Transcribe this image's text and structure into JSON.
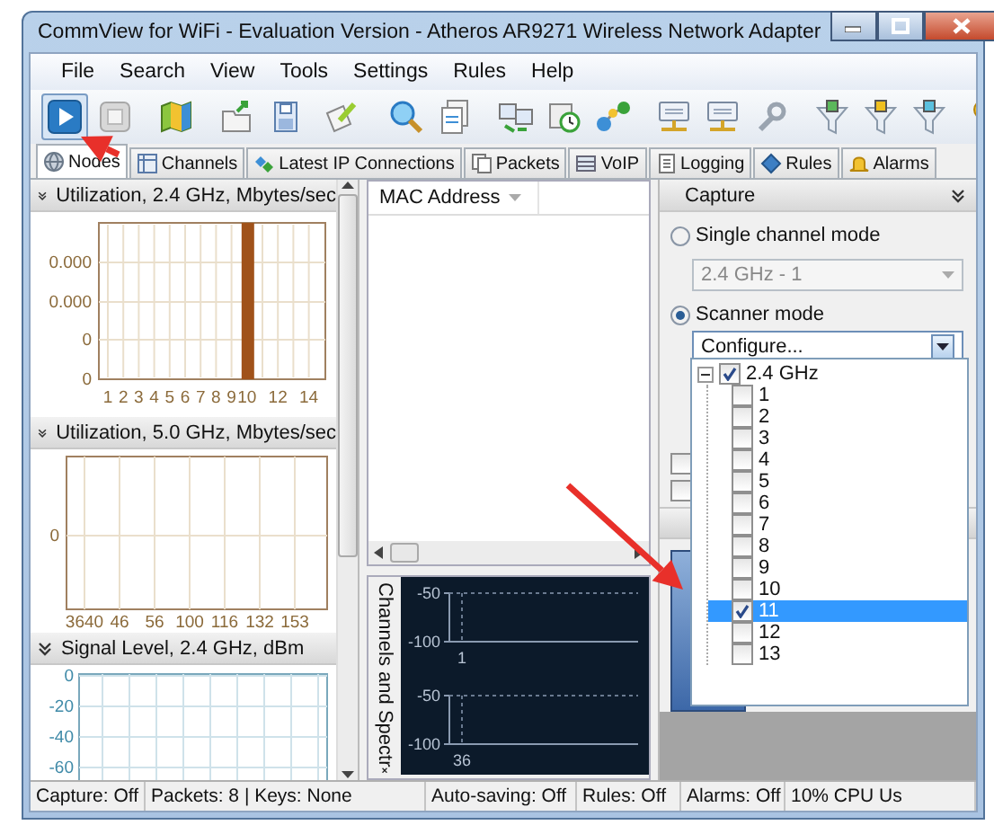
{
  "window": {
    "title": "CommView for WiFi - Evaluation Version - Atheros AR9271 Wireless Network Adapter"
  },
  "menu": [
    "File",
    "Search",
    "View",
    "Tools",
    "Settings",
    "Rules",
    "Help"
  ],
  "toolbar": [
    {
      "kind": "play",
      "pressed": true
    },
    {
      "kind": "stop",
      "pressed": false
    },
    {
      "kind": "separator"
    },
    {
      "kind": "map",
      "pressed": false
    },
    {
      "kind": "separator"
    },
    {
      "kind": "open",
      "pressed": false
    },
    {
      "kind": "save",
      "pressed": false
    },
    {
      "kind": "export",
      "pressed": false
    },
    {
      "kind": "separator"
    },
    {
      "kind": "search",
      "pressed": false
    },
    {
      "kind": "reports",
      "pressed": false
    },
    {
      "kind": "separator"
    },
    {
      "kind": "nodes",
      "pressed": false
    },
    {
      "kind": "schedule",
      "pressed": false
    },
    {
      "kind": "network",
      "pressed": false
    },
    {
      "kind": "separator"
    },
    {
      "kind": "device",
      "pressed": false
    },
    {
      "kind": "device",
      "pressed": false
    },
    {
      "kind": "wrench",
      "pressed": false
    },
    {
      "kind": "separator"
    },
    {
      "kind": "filtergreen",
      "pressed": false
    },
    {
      "kind": "filteryellow",
      "pressed": false
    },
    {
      "kind": "filterblue",
      "pressed": false
    },
    {
      "kind": "separator"
    },
    {
      "kind": "key",
      "pressed": false
    }
  ],
  "tabs": [
    {
      "label": "Nodes",
      "selected": true
    },
    {
      "label": "Channels",
      "selected": false
    },
    {
      "label": "Latest IP Connections",
      "selected": false
    },
    {
      "label": "Packets",
      "selected": false
    },
    {
      "label": "VoIP",
      "selected": false
    },
    {
      "label": "Logging",
      "selected": false
    },
    {
      "label": "Rules",
      "selected": false
    },
    {
      "label": "Alarms",
      "selected": false
    }
  ],
  "left_panel": {
    "sections": [
      {
        "title": "Utilization, 2.4 GHz, Mbytes/sec",
        "kind": "bars",
        "y_labels": [
          "0.000",
          "0.000",
          "0",
          "0"
        ],
        "x_slots": [
          {
            "label": "1",
            "bar": false
          },
          {
            "label": "2",
            "bar": false
          },
          {
            "label": "3",
            "bar": false
          },
          {
            "label": "4",
            "bar": false
          },
          {
            "label": "5",
            "bar": false
          },
          {
            "label": "6",
            "bar": false
          },
          {
            "label": "7",
            "bar": false
          },
          {
            "label": "8",
            "bar": false
          },
          {
            "label": "9",
            "bar": false
          },
          {
            "label": "10",
            "bar": true
          },
          {
            "bar": false
          },
          {
            "label": "12",
            "bar": false
          },
          {
            "bar": false
          },
          {
            "label": "14",
            "bar": false
          }
        ]
      },
      {
        "title": "Utilization, 5.0 GHz, Mbytes/sec",
        "kind": "plain",
        "y_labels": [
          "0"
        ],
        "x_labels": [
          "3640",
          "46",
          "56",
          "100",
          "116",
          "132",
          "153"
        ]
      },
      {
        "title": "Signal Level, 2.4 GHz, dBm",
        "kind": "signal",
        "y_labels": [
          "0",
          "-20",
          "-40",
          "-60"
        ]
      }
    ]
  },
  "nodes_table": {
    "columns": [
      "MAC Address"
    ]
  },
  "spectrum_panel": {
    "title": "Channels and Spectr",
    "graphs": [
      {
        "y_labels": [
          "-50",
          "-100"
        ],
        "x_label": "1"
      },
      {
        "y_labels": [
          "-50",
          "-100"
        ],
        "x_label": "36"
      }
    ]
  },
  "capture_panel": {
    "title": "Capture",
    "modes": [
      {
        "label": "Single channel mode",
        "selected": false,
        "value": "2.4 GHz - 1"
      },
      {
        "label": "Scanner mode",
        "selected": true,
        "value": "Configure..."
      }
    ],
    "background_checkboxes": [
      {
        "checked": false
      },
      {
        "checked": false
      }
    ],
    "channel_tree": [
      {
        "label": "2.4 GHz",
        "checked": true,
        "expanded": true,
        "selected": false,
        "children": [
          {
            "label": "1",
            "checked": false,
            "selected": false
          },
          {
            "label": "2",
            "checked": false,
            "selected": false
          },
          {
            "label": "3",
            "checked": false,
            "selected": false
          },
          {
            "label": "4",
            "checked": false,
            "selected": false
          },
          {
            "label": "5",
            "checked": false,
            "selected": false
          },
          {
            "label": "6",
            "checked": false,
            "selected": false
          },
          {
            "label": "7",
            "checked": false,
            "selected": false
          },
          {
            "label": "8",
            "checked": false,
            "selected": false
          },
          {
            "label": "9",
            "checked": false,
            "selected": false
          },
          {
            "label": "10",
            "checked": false,
            "selected": false
          },
          {
            "label": "11",
            "checked": true,
            "selected": true
          },
          {
            "label": "12",
            "checked": false,
            "selected": false
          },
          {
            "label": "13",
            "checked": false,
            "selected": false
          }
        ]
      }
    ]
  },
  "status_bar": [
    "Capture: Off",
    "Packets: 8 | Keys: None",
    "Auto-saving: Off",
    "Rules: Off",
    "Alarms: Off",
    "10% CPU Us"
  ]
}
